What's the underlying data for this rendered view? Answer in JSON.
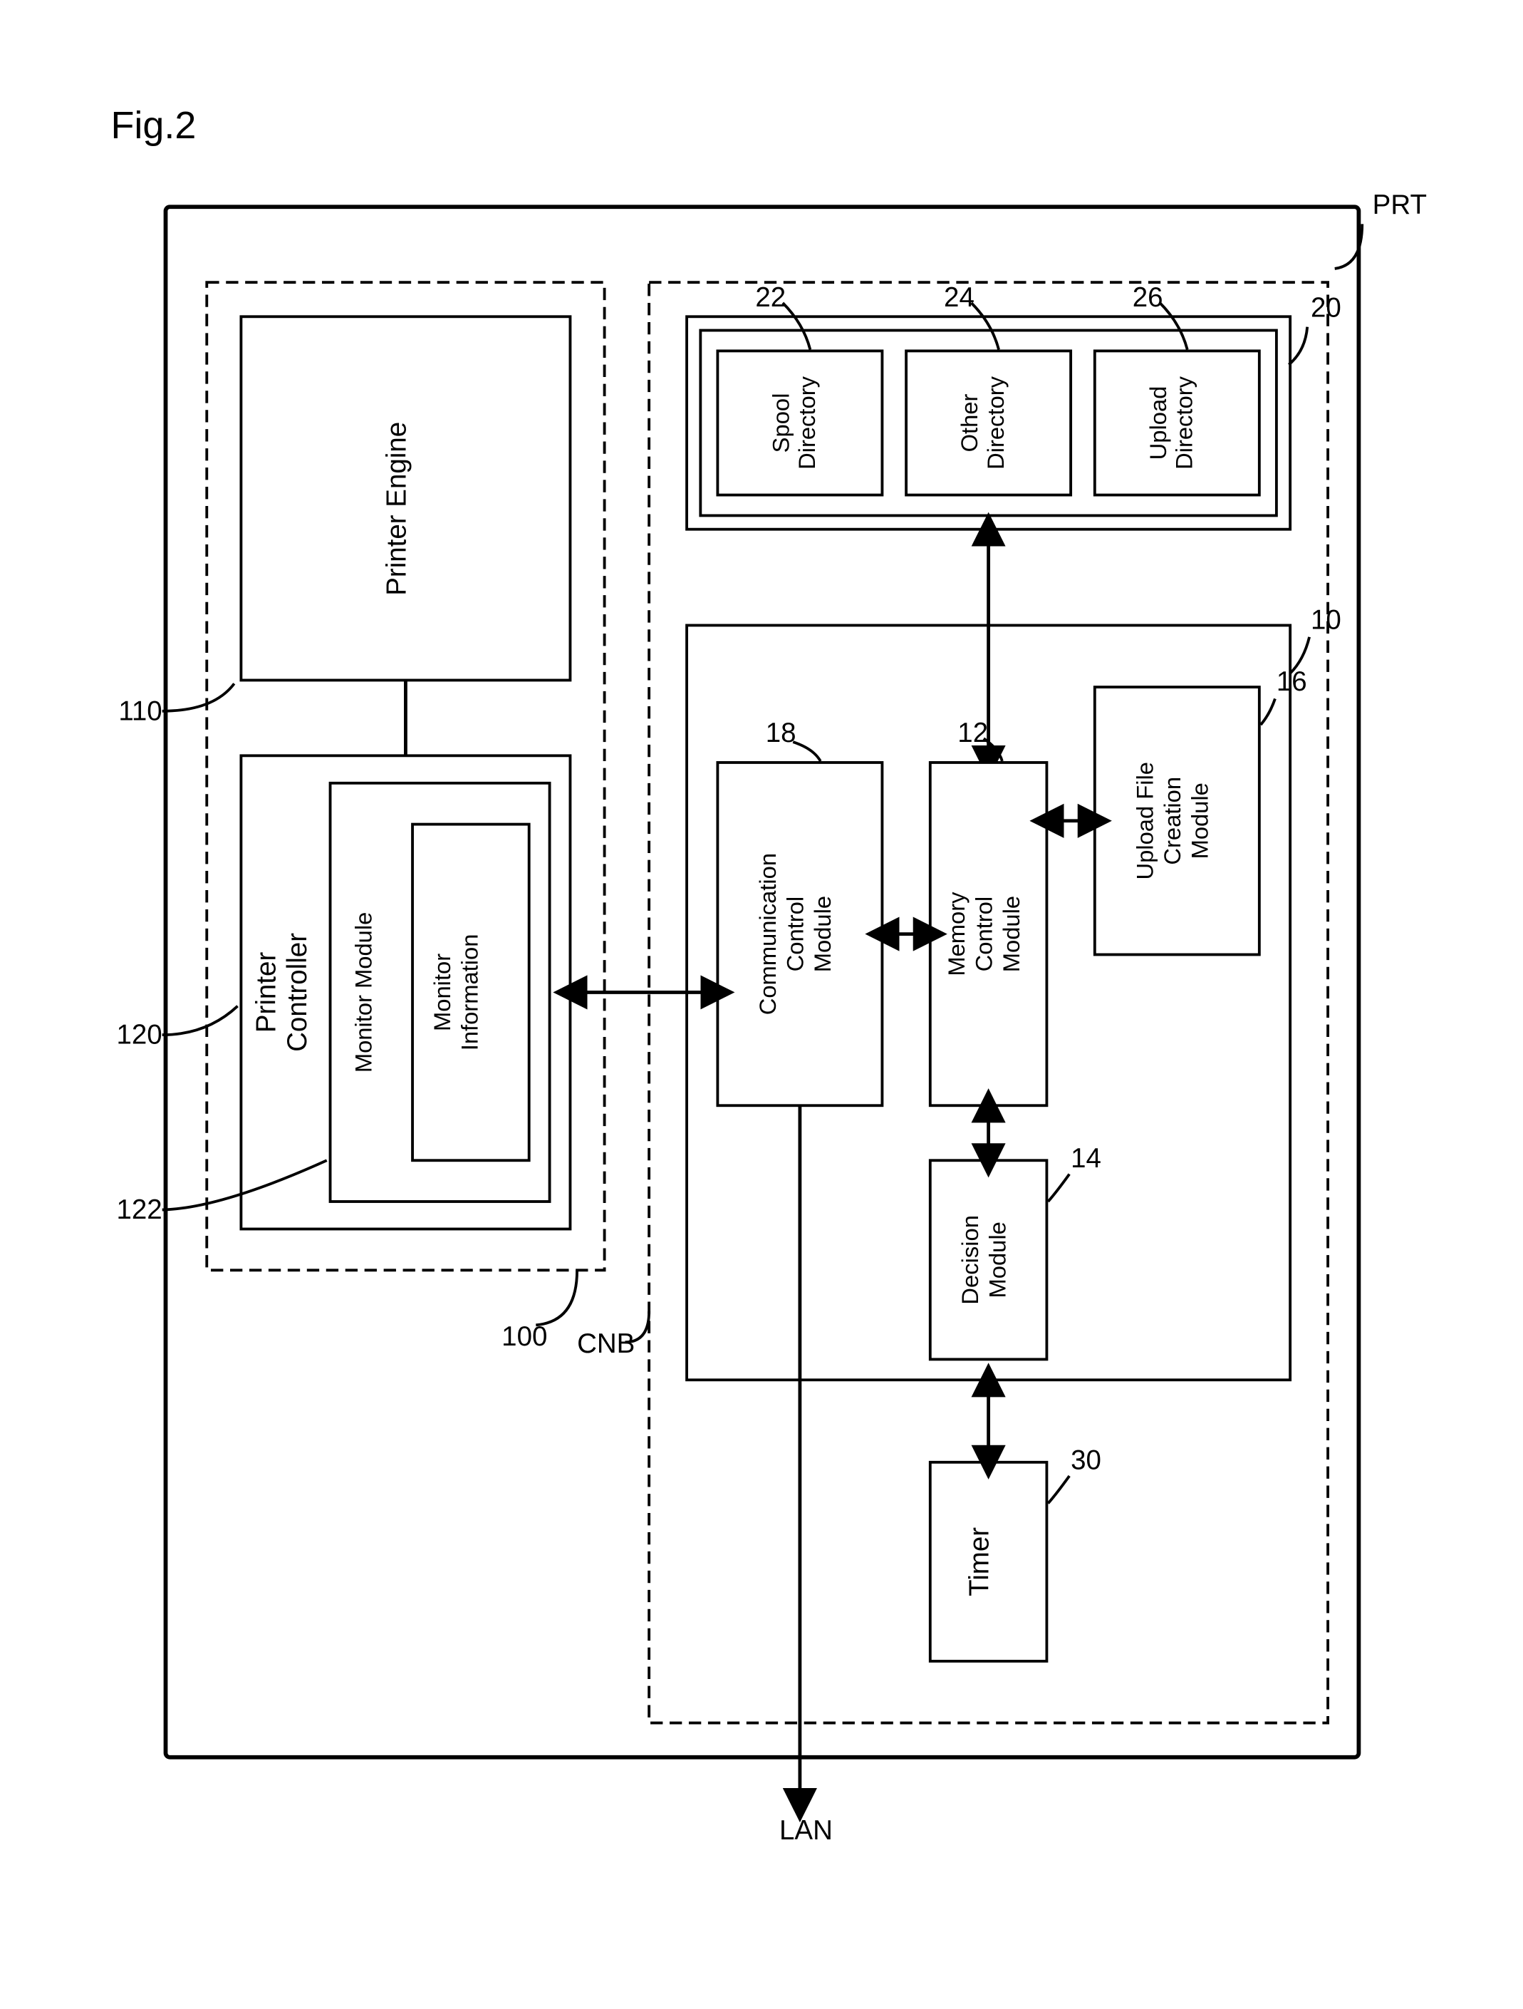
{
  "figure": "Fig.2",
  "outer": {
    "prt": "PRT",
    "lan": "LAN",
    "cnb": "CNB"
  },
  "left": {
    "engine": "Printer Engine",
    "controller": "Printer\nController",
    "monitorModule": "Monitor Module",
    "monitorInfo": "Monitor\nInformation",
    "n100": "100",
    "n110": "110",
    "n120": "120",
    "n122": "122"
  },
  "storage": {
    "spool": "Spool\nDirectory",
    "other": "Other\nDirectory",
    "upload": "Upload\nDirectory",
    "n20": "20",
    "n22": "22",
    "n24": "24",
    "n26": "26"
  },
  "modules": {
    "n10": "10",
    "comm": "Communication\nControl\nModule",
    "n18": "18",
    "memory": "Memory\nControl\nModule",
    "n12": "12",
    "uploadFile": "Upload File\nCreation\nModule",
    "n16": "16",
    "decision": "Decision\nModule",
    "n14": "14",
    "timer": "Timer",
    "n30": "30"
  }
}
